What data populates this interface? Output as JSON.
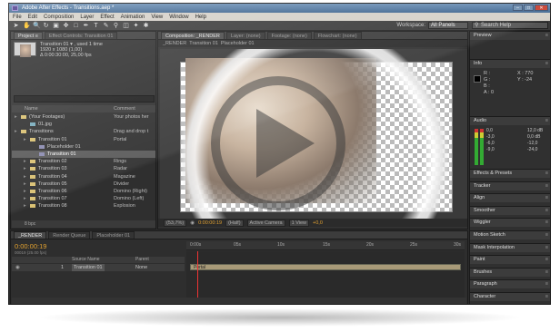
{
  "window": {
    "title": "Adobe After Effects - Transitions.aep *"
  },
  "menu": [
    "File",
    "Edit",
    "Composition",
    "Layer",
    "Effect",
    "Animation",
    "View",
    "Window",
    "Help"
  ],
  "workspace": {
    "label": "Workspace:",
    "value": "All Panels"
  },
  "search_help": {
    "placeholder": "Search Help"
  },
  "project": {
    "tabs": [
      "Project ≡",
      "Effect Controls: Transition 01"
    ],
    "selected_name": "Transition 01 ▾ , used 1 time",
    "dimensions": "1920 x 1080 (1,00)",
    "duration": "Δ 0:00:30:00, 25,00 fps",
    "col_name": "Name",
    "col_comment": "Comment",
    "rows": [
      {
        "indent": 0,
        "name": "(Your Footages)",
        "comment": "Your photos her",
        "type": "folder"
      },
      {
        "indent": 1,
        "name": "01.jpg",
        "comment": "",
        "type": "file"
      },
      {
        "indent": 0,
        "name": "Transitions",
        "comment": "Drag and drop t",
        "type": "folder"
      },
      {
        "indent": 1,
        "name": "Transition 01",
        "comment": "Portal",
        "type": "folder"
      },
      {
        "indent": 2,
        "name": "Placeholder 01",
        "comment": "",
        "type": "comp"
      },
      {
        "indent": 2,
        "name": "Transition 01",
        "comment": "",
        "type": "comp",
        "selected": true
      },
      {
        "indent": 1,
        "name": "Transition 02",
        "comment": "Rings",
        "type": "folder"
      },
      {
        "indent": 1,
        "name": "Transition 03",
        "comment": "Radar",
        "type": "folder"
      },
      {
        "indent": 1,
        "name": "Transition 04",
        "comment": "Magazine",
        "type": "folder"
      },
      {
        "indent": 1,
        "name": "Transition 05",
        "comment": "Divider",
        "type": "folder"
      },
      {
        "indent": 1,
        "name": "Transition 06",
        "comment": "Domino (Right)",
        "type": "folder"
      },
      {
        "indent": 1,
        "name": "Transition 07",
        "comment": "Domino (Left)",
        "type": "folder"
      },
      {
        "indent": 1,
        "name": "Transition 08",
        "comment": "Explosion",
        "type": "folder"
      }
    ],
    "footer": "8 bpc"
  },
  "composition": {
    "tabs": [
      "Composition: _RENDER",
      "Layer: (none)",
      "Footage: (none)",
      "Flowchart: (none)"
    ],
    "subtabs": [
      "_RENDER",
      "Transition 01",
      "Placeholder 01"
    ],
    "zoom": "(53,7%)",
    "time": "0:00:00:19",
    "resolution": "(Half)",
    "camera": "Active Camera",
    "views": "1 View",
    "exposure": "+0,0"
  },
  "right_panels": {
    "preview": "Preview",
    "info": "Info",
    "info_r": "R :",
    "info_g": "G :",
    "info_b": "B :",
    "info_a": "A : 0",
    "info_x": "X : 770",
    "info_y": "Y : -24",
    "audio": "Audio",
    "audio_l": [
      "0,0",
      "-3,0",
      "-6,0",
      "-9,0"
    ],
    "audio_r": [
      "12,0 dB",
      "0,0 dB",
      "-12,0",
      "-24,0"
    ],
    "list": [
      "Effects & Presets",
      "Tracker",
      "Align",
      "Smoother",
      "Wiggler",
      "Motion Sketch",
      "Mask Interpolation",
      "Paint",
      "Brushes",
      "Paragraph",
      "Character"
    ]
  },
  "timeline": {
    "tabs": [
      "_RENDER",
      "Render Queue",
      "Placeholder 01"
    ],
    "time": "0:00:00:19",
    "fps": "00019 (25.00 fps)",
    "col_source": "Source Name",
    "col_parent": "Parent",
    "layer_num": "1",
    "layer_name": "Transition 01",
    "layer_parent": "None",
    "bar_label": "Portal",
    "ruler": [
      "0:00s",
      "05s",
      "10s",
      "15s",
      "20s",
      "25s",
      "30s"
    ]
  },
  "colors": {
    "accent": "#e0a030",
    "panel": "#2f2f2f",
    "title": "#4a7099"
  }
}
